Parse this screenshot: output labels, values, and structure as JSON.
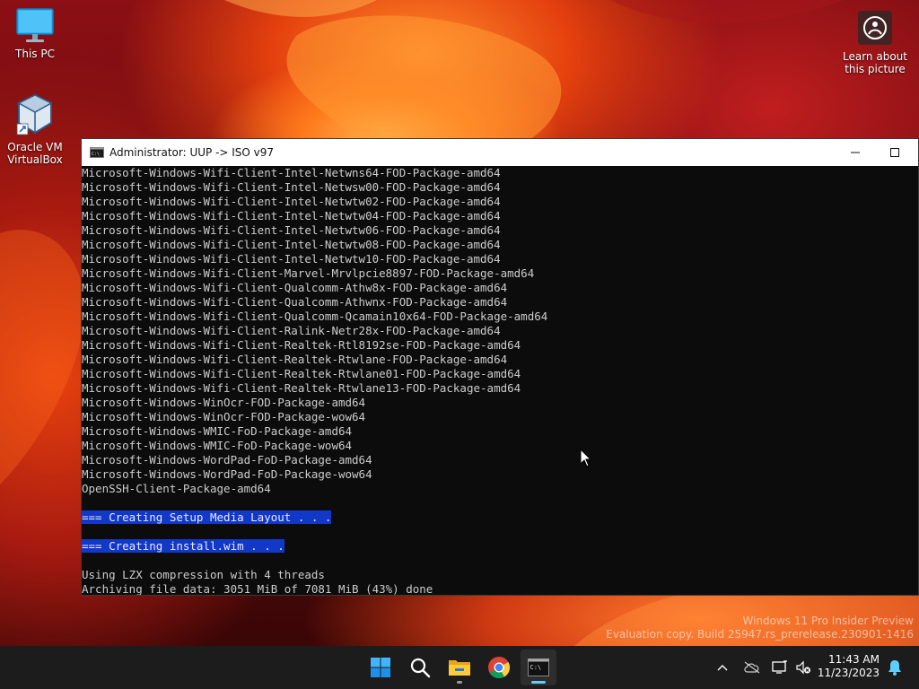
{
  "desktop": {
    "icons": [
      {
        "label": "This PC"
      },
      {
        "label_line1": "Oracle VM",
        "label_line2": "VirtualBox"
      }
    ],
    "spotlight": {
      "line1": "Learn about",
      "line2": "this picture"
    }
  },
  "window": {
    "title": "Administrator:  UUP -> ISO v97",
    "lines": [
      {
        "text": "Microsoft-Windows-Wifi-Client-Intel-Netwns64-FOD-Package-amd64"
      },
      {
        "text": "Microsoft-Windows-Wifi-Client-Intel-Netwsw00-FOD-Package-amd64"
      },
      {
        "text": "Microsoft-Windows-Wifi-Client-Intel-Netwtw02-FOD-Package-amd64"
      },
      {
        "text": "Microsoft-Windows-Wifi-Client-Intel-Netwtw04-FOD-Package-amd64"
      },
      {
        "text": "Microsoft-Windows-Wifi-Client-Intel-Netwtw06-FOD-Package-amd64"
      },
      {
        "text": "Microsoft-Windows-Wifi-Client-Intel-Netwtw08-FOD-Package-amd64"
      },
      {
        "text": "Microsoft-Windows-Wifi-Client-Intel-Netwtw10-FOD-Package-amd64"
      },
      {
        "text": "Microsoft-Windows-Wifi-Client-Marvel-Mrvlpcie8897-FOD-Package-amd64"
      },
      {
        "text": "Microsoft-Windows-Wifi-Client-Qualcomm-Athw8x-FOD-Package-amd64"
      },
      {
        "text": "Microsoft-Windows-Wifi-Client-Qualcomm-Athwnx-FOD-Package-amd64"
      },
      {
        "text": "Microsoft-Windows-Wifi-Client-Qualcomm-Qcamain10x64-FOD-Package-amd64"
      },
      {
        "text": "Microsoft-Windows-Wifi-Client-Ralink-Netr28x-FOD-Package-amd64"
      },
      {
        "text": "Microsoft-Windows-Wifi-Client-Realtek-Rtl8192se-FOD-Package-amd64"
      },
      {
        "text": "Microsoft-Windows-Wifi-Client-Realtek-Rtwlane-FOD-Package-amd64"
      },
      {
        "text": "Microsoft-Windows-Wifi-Client-Realtek-Rtwlane01-FOD-Package-amd64"
      },
      {
        "text": "Microsoft-Windows-Wifi-Client-Realtek-Rtwlane13-FOD-Package-amd64"
      },
      {
        "text": "Microsoft-Windows-WinOcr-FOD-Package-amd64"
      },
      {
        "text": "Microsoft-Windows-WinOcr-FOD-Package-wow64"
      },
      {
        "text": "Microsoft-Windows-WMIC-FoD-Package-amd64"
      },
      {
        "text": "Microsoft-Windows-WMIC-FoD-Package-wow64"
      },
      {
        "text": "Microsoft-Windows-WordPad-FoD-Package-amd64"
      },
      {
        "text": "Microsoft-Windows-WordPad-FoD-Package-wow64"
      },
      {
        "text": "OpenSSH-Client-Package-amd64"
      },
      {
        "text": ""
      },
      {
        "text": "=== Creating Setup Media Layout . . .",
        "highlight": true
      },
      {
        "text": ""
      },
      {
        "text": "=== Creating install.wim . . .",
        "highlight": true
      },
      {
        "text": ""
      },
      {
        "text": "Using LZX compression with 4 threads"
      },
      {
        "text": "Archiving file data: 3051 MiB of 7081 MiB (43%) done"
      }
    ]
  },
  "watermark": {
    "line1": "Windows 11 Pro Insider Preview",
    "line2": "Evaluation copy. Build 25947.rs_prerelease.230901-1416"
  },
  "taskbar": {
    "apps": [
      {
        "name": "start-button",
        "icon": "windows-logo-icon"
      },
      {
        "name": "search-button",
        "icon": "search-icon"
      },
      {
        "name": "file-explorer-button",
        "icon": "folder-icon"
      },
      {
        "name": "chrome-button",
        "icon": "chrome-icon"
      },
      {
        "name": "terminal-button",
        "icon": "console-icon"
      }
    ],
    "clock": {
      "time": "11:43 AM",
      "date": "11/23/2023"
    }
  },
  "colors": {
    "highlight_bg": "#1238c8",
    "console_text": "#cccccc",
    "taskbar_bg": "#1c1c1c",
    "accent": "#60cdff"
  }
}
